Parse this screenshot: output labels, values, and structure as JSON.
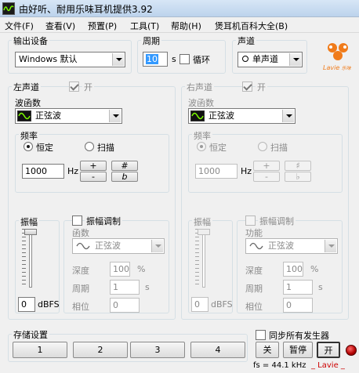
{
  "window": {
    "title": "由好听、耐用乐味耳机提供3.92"
  },
  "menu": [
    {
      "label": "文件(F)"
    },
    {
      "label": "查看(V)"
    },
    {
      "label": "预置(P)"
    },
    {
      "label": "工具(T)"
    },
    {
      "label": "帮助(H)"
    },
    {
      "label": "煲耳机百科大全(B)"
    }
  ],
  "output": {
    "group_label": "输出设备",
    "device_value": "Windows 默认"
  },
  "period": {
    "group_label": "周期",
    "value": "10",
    "unit": "s",
    "loop_label": "循环",
    "loop_checked": false
  },
  "channel": {
    "group_label": "声道",
    "value": "单声道"
  },
  "logo": {
    "text": "Lavie",
    "sub_text": "乐味",
    "accent_color": "#f07b1a"
  },
  "left_channel": {
    "group_label": "左声道",
    "enable_label": "开",
    "enabled_checked": true,
    "waveform_label": "波函数",
    "waveform_value": "正弦波",
    "frequency": {
      "group_label": "频率",
      "mode_fixed": "恒定",
      "mode_sweep": "扫描",
      "selected_mode": "恒定",
      "value": "1000",
      "unit": "Hz",
      "btn_plus": "+",
      "btn_minus": "-",
      "btn_sharp": "#",
      "btn_flat": "b"
    },
    "amplitude": {
      "group_label": "振幅",
      "value": "0",
      "unit": "dBFS",
      "level_fraction": 1.0
    },
    "am": {
      "label": "振幅调制",
      "checked": false,
      "function_label": "函数",
      "function_value": "正弦波",
      "depth_label": "深度",
      "depth_value": "100",
      "depth_unit": "%",
      "period_label": "周期",
      "period_value": "1",
      "period_unit": "s",
      "phase_label": "相位",
      "phase_value": "0"
    }
  },
  "right_channel": {
    "group_label": "右声道",
    "enable_label": "开",
    "enabled_checked": true,
    "waveform_label": "波函数",
    "waveform_value": "正弦波",
    "frequency": {
      "group_label": "频率",
      "mode_fixed": "恒定",
      "mode_sweep": "扫描",
      "selected_mode": "恒定",
      "value": "1000",
      "unit": "Hz",
      "btn_plus": "+",
      "btn_minus": "-",
      "btn_sharp": "♯",
      "btn_flat": "♭"
    },
    "amplitude": {
      "group_label": "振幅",
      "value": "0",
      "unit": "dBFS",
      "level_fraction": 1.0
    },
    "am": {
      "label": "振幅调制",
      "checked": false,
      "function_label": "功能",
      "function_value": "正弦波",
      "depth_label": "深度",
      "depth_value": "100",
      "depth_unit": "%",
      "period_label": "周期",
      "period_value": "1",
      "period_unit": "s",
      "phase_label": "相位",
      "phase_value": "0"
    }
  },
  "storage": {
    "group_label": "存储设置",
    "slots": [
      "1",
      "2",
      "3",
      "4"
    ]
  },
  "sync": {
    "label": "同步所有发生器",
    "checked": false
  },
  "controls": {
    "off_label": "关",
    "pause_label": "暂停",
    "on_label": "开"
  },
  "status": {
    "sample_rate": "fs = 44.1 kHz",
    "brand": "_ Lavie _",
    "brand_color": "#cc0000"
  }
}
